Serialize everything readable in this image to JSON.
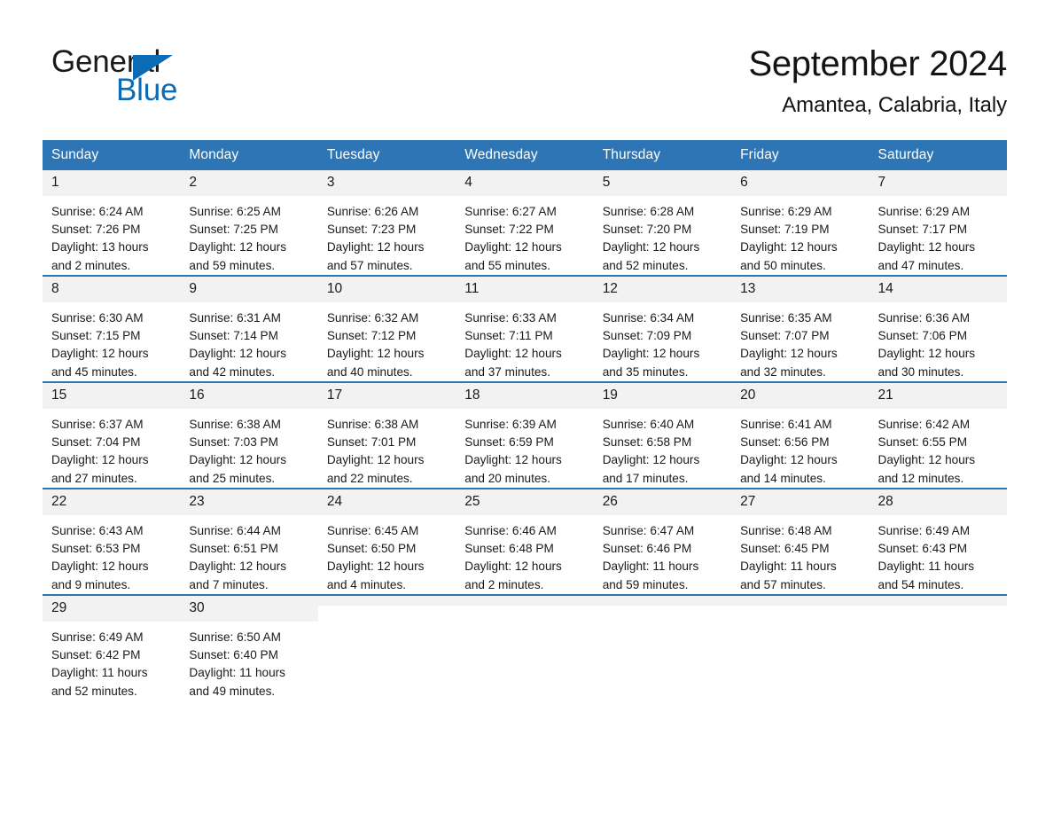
{
  "brand": {
    "name_part1": "General",
    "name_part2": "Blue",
    "accent_color": "#0b6cb5"
  },
  "header": {
    "title": "September 2024",
    "location": "Amantea, Calabria, Italy",
    "header_bg_color": "#2e75b6",
    "daynum_bg_color": "#f2f2f2"
  },
  "calendar": {
    "weekday_headers": [
      "Sunday",
      "Monday",
      "Tuesday",
      "Wednesday",
      "Thursday",
      "Friday",
      "Saturday"
    ],
    "weeks": [
      [
        {
          "day": "1",
          "sunrise": "Sunrise: 6:24 AM",
          "sunset": "Sunset: 7:26 PM",
          "daylight_line1": "Daylight: 13 hours",
          "daylight_line2": "and 2 minutes."
        },
        {
          "day": "2",
          "sunrise": "Sunrise: 6:25 AM",
          "sunset": "Sunset: 7:25 PM",
          "daylight_line1": "Daylight: 12 hours",
          "daylight_line2": "and 59 minutes."
        },
        {
          "day": "3",
          "sunrise": "Sunrise: 6:26 AM",
          "sunset": "Sunset: 7:23 PM",
          "daylight_line1": "Daylight: 12 hours",
          "daylight_line2": "and 57 minutes."
        },
        {
          "day": "4",
          "sunrise": "Sunrise: 6:27 AM",
          "sunset": "Sunset: 7:22 PM",
          "daylight_line1": "Daylight: 12 hours",
          "daylight_line2": "and 55 minutes."
        },
        {
          "day": "5",
          "sunrise": "Sunrise: 6:28 AM",
          "sunset": "Sunset: 7:20 PM",
          "daylight_line1": "Daylight: 12 hours",
          "daylight_line2": "and 52 minutes."
        },
        {
          "day": "6",
          "sunrise": "Sunrise: 6:29 AM",
          "sunset": "Sunset: 7:19 PM",
          "daylight_line1": "Daylight: 12 hours",
          "daylight_line2": "and 50 minutes."
        },
        {
          "day": "7",
          "sunrise": "Sunrise: 6:29 AM",
          "sunset": "Sunset: 7:17 PM",
          "daylight_line1": "Daylight: 12 hours",
          "daylight_line2": "and 47 minutes."
        }
      ],
      [
        {
          "day": "8",
          "sunrise": "Sunrise: 6:30 AM",
          "sunset": "Sunset: 7:15 PM",
          "daylight_line1": "Daylight: 12 hours",
          "daylight_line2": "and 45 minutes."
        },
        {
          "day": "9",
          "sunrise": "Sunrise: 6:31 AM",
          "sunset": "Sunset: 7:14 PM",
          "daylight_line1": "Daylight: 12 hours",
          "daylight_line2": "and 42 minutes."
        },
        {
          "day": "10",
          "sunrise": "Sunrise: 6:32 AM",
          "sunset": "Sunset: 7:12 PM",
          "daylight_line1": "Daylight: 12 hours",
          "daylight_line2": "and 40 minutes."
        },
        {
          "day": "11",
          "sunrise": "Sunrise: 6:33 AM",
          "sunset": "Sunset: 7:11 PM",
          "daylight_line1": "Daylight: 12 hours",
          "daylight_line2": "and 37 minutes."
        },
        {
          "day": "12",
          "sunrise": "Sunrise: 6:34 AM",
          "sunset": "Sunset: 7:09 PM",
          "daylight_line1": "Daylight: 12 hours",
          "daylight_line2": "and 35 minutes."
        },
        {
          "day": "13",
          "sunrise": "Sunrise: 6:35 AM",
          "sunset": "Sunset: 7:07 PM",
          "daylight_line1": "Daylight: 12 hours",
          "daylight_line2": "and 32 minutes."
        },
        {
          "day": "14",
          "sunrise": "Sunrise: 6:36 AM",
          "sunset": "Sunset: 7:06 PM",
          "daylight_line1": "Daylight: 12 hours",
          "daylight_line2": "and 30 minutes."
        }
      ],
      [
        {
          "day": "15",
          "sunrise": "Sunrise: 6:37 AM",
          "sunset": "Sunset: 7:04 PM",
          "daylight_line1": "Daylight: 12 hours",
          "daylight_line2": "and 27 minutes."
        },
        {
          "day": "16",
          "sunrise": "Sunrise: 6:38 AM",
          "sunset": "Sunset: 7:03 PM",
          "daylight_line1": "Daylight: 12 hours",
          "daylight_line2": "and 25 minutes."
        },
        {
          "day": "17",
          "sunrise": "Sunrise: 6:38 AM",
          "sunset": "Sunset: 7:01 PM",
          "daylight_line1": "Daylight: 12 hours",
          "daylight_line2": "and 22 minutes."
        },
        {
          "day": "18",
          "sunrise": "Sunrise: 6:39 AM",
          "sunset": "Sunset: 6:59 PM",
          "daylight_line1": "Daylight: 12 hours",
          "daylight_line2": "and 20 minutes."
        },
        {
          "day": "19",
          "sunrise": "Sunrise: 6:40 AM",
          "sunset": "Sunset: 6:58 PM",
          "daylight_line1": "Daylight: 12 hours",
          "daylight_line2": "and 17 minutes."
        },
        {
          "day": "20",
          "sunrise": "Sunrise: 6:41 AM",
          "sunset": "Sunset: 6:56 PM",
          "daylight_line1": "Daylight: 12 hours",
          "daylight_line2": "and 14 minutes."
        },
        {
          "day": "21",
          "sunrise": "Sunrise: 6:42 AM",
          "sunset": "Sunset: 6:55 PM",
          "daylight_line1": "Daylight: 12 hours",
          "daylight_line2": "and 12 minutes."
        }
      ],
      [
        {
          "day": "22",
          "sunrise": "Sunrise: 6:43 AM",
          "sunset": "Sunset: 6:53 PM",
          "daylight_line1": "Daylight: 12 hours",
          "daylight_line2": "and 9 minutes."
        },
        {
          "day": "23",
          "sunrise": "Sunrise: 6:44 AM",
          "sunset": "Sunset: 6:51 PM",
          "daylight_line1": "Daylight: 12 hours",
          "daylight_line2": "and 7 minutes."
        },
        {
          "day": "24",
          "sunrise": "Sunrise: 6:45 AM",
          "sunset": "Sunset: 6:50 PM",
          "daylight_line1": "Daylight: 12 hours",
          "daylight_line2": "and 4 minutes."
        },
        {
          "day": "25",
          "sunrise": "Sunrise: 6:46 AM",
          "sunset": "Sunset: 6:48 PM",
          "daylight_line1": "Daylight: 12 hours",
          "daylight_line2": "and 2 minutes."
        },
        {
          "day": "26",
          "sunrise": "Sunrise: 6:47 AM",
          "sunset": "Sunset: 6:46 PM",
          "daylight_line1": "Daylight: 11 hours",
          "daylight_line2": "and 59 minutes."
        },
        {
          "day": "27",
          "sunrise": "Sunrise: 6:48 AM",
          "sunset": "Sunset: 6:45 PM",
          "daylight_line1": "Daylight: 11 hours",
          "daylight_line2": "and 57 minutes."
        },
        {
          "day": "28",
          "sunrise": "Sunrise: 6:49 AM",
          "sunset": "Sunset: 6:43 PM",
          "daylight_line1": "Daylight: 11 hours",
          "daylight_line2": "and 54 minutes."
        }
      ],
      [
        {
          "day": "29",
          "sunrise": "Sunrise: 6:49 AM",
          "sunset": "Sunset: 6:42 PM",
          "daylight_line1": "Daylight: 11 hours",
          "daylight_line2": "and 52 minutes."
        },
        {
          "day": "30",
          "sunrise": "Sunrise: 6:50 AM",
          "sunset": "Sunset: 6:40 PM",
          "daylight_line1": "Daylight: 11 hours",
          "daylight_line2": "and 49 minutes."
        },
        {
          "day": "",
          "sunrise": "",
          "sunset": "",
          "daylight_line1": "",
          "daylight_line2": ""
        },
        {
          "day": "",
          "sunrise": "",
          "sunset": "",
          "daylight_line1": "",
          "daylight_line2": ""
        },
        {
          "day": "",
          "sunrise": "",
          "sunset": "",
          "daylight_line1": "",
          "daylight_line2": ""
        },
        {
          "day": "",
          "sunrise": "",
          "sunset": "",
          "daylight_line1": "",
          "daylight_line2": ""
        },
        {
          "day": "",
          "sunrise": "",
          "sunset": "",
          "daylight_line1": "",
          "daylight_line2": ""
        }
      ]
    ]
  }
}
